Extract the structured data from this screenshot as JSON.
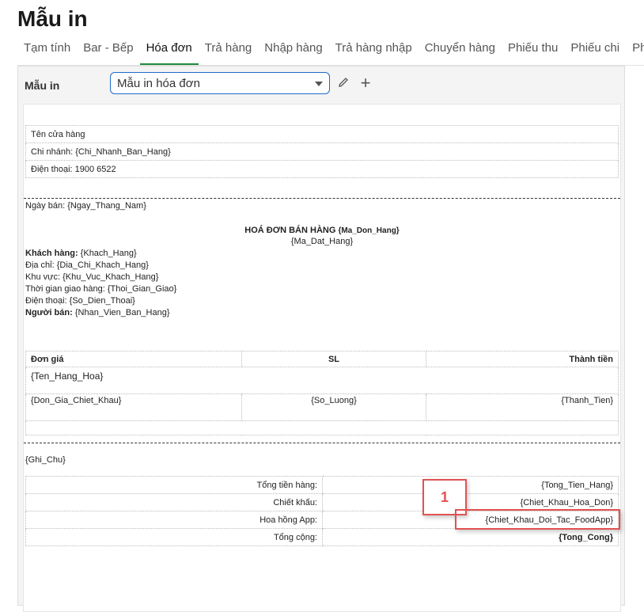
{
  "title": "Mẫu in",
  "tabs": [
    "Tạm tính",
    "Bar - Bếp",
    "Hóa đơn",
    "Trả hàng",
    "Nhập hàng",
    "Trả hàng nhập",
    "Chuyển hàng",
    "Phiếu thu",
    "Phiếu chi",
    "Phiế"
  ],
  "active_tab": "Hóa đơn",
  "controls": {
    "label": "Mẫu in",
    "select_value": "Mẫu in hóa đơn",
    "edit_icon": "pencil-icon",
    "add_icon": "plus-icon"
  },
  "store": {
    "name": "Tên cửa hàng",
    "branch": "Chi nhánh: {Chi_Nhanh_Ban_Hang}",
    "phone": "Điện thoại: 1900 6522"
  },
  "order": {
    "date": "Ngày bán: {Ngay_Thang_Nam}",
    "heading": "HOÁ ĐƠN BÁN HÀNG",
    "order_code": "{Ma_Don_Hang}",
    "booking_code": "{Ma_Dat_Hang}",
    "customer_label": "Khách hàng:",
    "customer_value": " {Khach_Hang}",
    "address": "Địa chỉ: {Dia_Chi_Khach_Hang}",
    "area": "Khu vực: {Khu_Vuc_Khach_Hang}",
    "delivery_time": "Thời gian giao hàng: {Thoi_Gian_Giao}",
    "phone": "Điện thoại: {So_Dien_Thoai}",
    "seller_label": "Người bán:",
    "seller_value": " {Nhan_Vien_Ban_Hang}"
  },
  "items": {
    "headers": [
      "Đơn giá",
      "SL",
      "Thành tiền"
    ],
    "product": "{Ten_Hang_Hoa}",
    "row": [
      "{Don_Gia_Chiet_Khau}",
      "{So_Luong}",
      "{Thanh_Tien}"
    ]
  },
  "note": "{Ghi_Chu}",
  "totals": [
    {
      "label": "Tổng tiền hàng:",
      "value": "{Tong_Tien_Hang}"
    },
    {
      "label": "Chiết khấu:",
      "value": "{Chiet_Khau_Hoa_Don}"
    },
    {
      "label": "Hoa hồng App:",
      "value": "{Chiet_Khau_Doi_Tac_FoodApp}"
    },
    {
      "label": "Tổng cộng:",
      "value": "{Tong_Cong}"
    }
  ],
  "callout": "1",
  "colors": {
    "accent_tab": "#1f8a3a",
    "select_border": "#1e6bc9",
    "callout": "#e15252"
  }
}
